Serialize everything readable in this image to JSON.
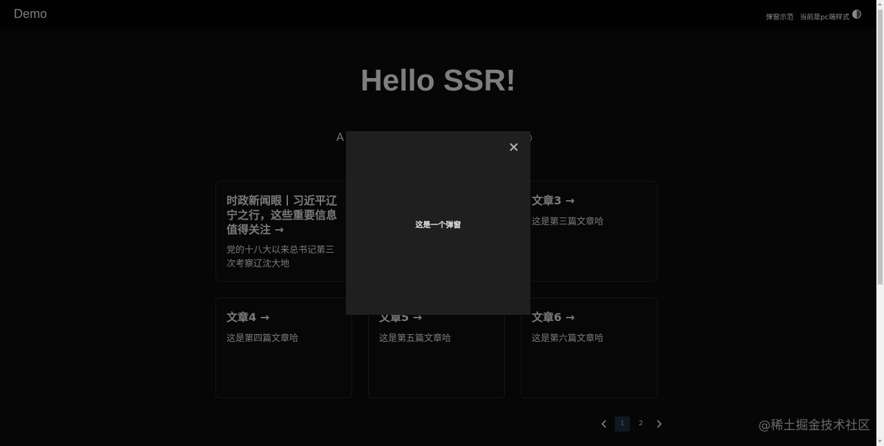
{
  "header": {
    "logo": "Demo",
    "nav": {
      "modal_demo": "弹窗示范",
      "mode_label": "当前是pc端样式"
    },
    "theme_toggle_icon": "half-moon-icon"
  },
  "hero": {
    "title": "Hello SSR!",
    "subtitle_left": "A",
    "subtitle_right": "》"
  },
  "cards": [
    {
      "title": "时政新闻眼丨习近平辽宁之行，这些重要信息值得关注 →",
      "desc": "党的十八大以来总书记第三次考察辽沈大地"
    },
    {
      "title": "",
      "desc": ""
    },
    {
      "title": "文章3 →",
      "desc": "这是第三篇文章哈"
    },
    {
      "title": "文章4 →",
      "desc": "这是第四篇文章哈"
    },
    {
      "title": "文章5 →",
      "desc": "这是第五篇文章哈"
    },
    {
      "title": "文章6 →",
      "desc": "这是第六篇文章哈"
    }
  ],
  "pagination": {
    "prev_icon": "chevron-left-icon",
    "next_icon": "chevron-right-icon",
    "pages": [
      "1",
      "2"
    ],
    "current": "1"
  },
  "modal": {
    "text": "这是一个弹窗",
    "close_icon": "close-icon"
  },
  "watermark": "@稀土掘金技术社区",
  "colors": {
    "background": "#060606",
    "header": "#020202",
    "modal": "#1f1f1f",
    "text_muted": "#7b7b7b",
    "active_page": "#101822"
  }
}
